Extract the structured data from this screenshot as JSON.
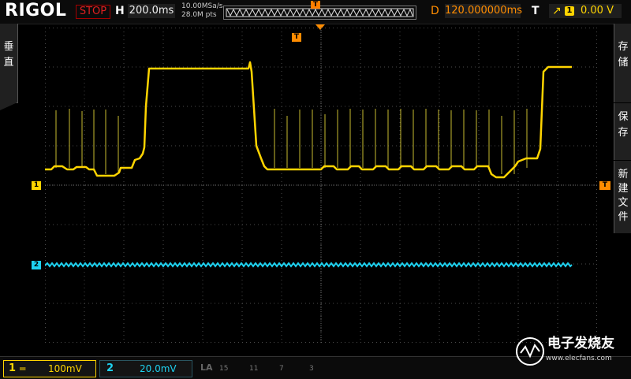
{
  "header": {
    "brand": "RIGOL",
    "run_state": "STOP",
    "horizontal_label": "H",
    "timebase": "200.0ms",
    "sample_rate": "10.00MSa/s",
    "memory_depth": "28.0M pts",
    "trigger_marker": "T",
    "delay_label": "D",
    "delay_value": "120.000000ms",
    "trigger_label": "T",
    "trigger_edge": "↗",
    "trigger_source": "1",
    "trigger_level": "0.00 V"
  },
  "left_panel": {
    "chars": [
      "垂",
      "直"
    ]
  },
  "right_panel": {
    "groups": [
      {
        "chars": [
          "存",
          "储"
        ]
      },
      {
        "chars": [
          "保",
          "存"
        ]
      },
      {
        "chars": [
          "新",
          "建",
          "文",
          "件"
        ]
      }
    ]
  },
  "markers": {
    "ch1": "1",
    "ch2": "2",
    "trigger_top": "T",
    "trigger_right": "T"
  },
  "channels": [
    {
      "num": "1",
      "coupling": "═",
      "scale": "100mV",
      "color": "#ffd400"
    },
    {
      "num": "2",
      "scale": "20.0mV",
      "color": "#1ed2f0"
    }
  ],
  "la": {
    "label": "LA",
    "groups": [
      "15",
      "11",
      "7",
      "3"
    ]
  },
  "watermark": {
    "name": "电子发烧友",
    "url": "www.elecfans.com"
  },
  "colors": {
    "ch1": "#ffd400",
    "ch2": "#1ed2f0",
    "trigger": "#ff8c00",
    "stop": "#e02020"
  }
}
